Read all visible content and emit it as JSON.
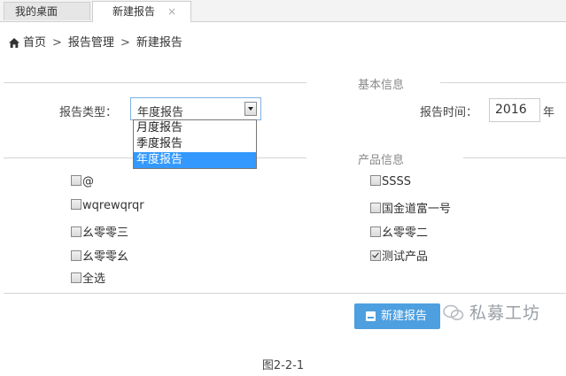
{
  "tabs": [
    {
      "label": "我的桌面"
    },
    {
      "label": "新建报告",
      "close": "×"
    }
  ],
  "breadcrumb": {
    "items": [
      "首页",
      "报告管理",
      "新建报告"
    ],
    "separator": ">"
  },
  "sections": {
    "basic": "基本信息",
    "product": "产品信息"
  },
  "report_type": {
    "label": "报告类型：",
    "value": "年度报告",
    "options": [
      "月度报告",
      "季度报告",
      "年度报告"
    ]
  },
  "report_time": {
    "label": "报告时间：",
    "year": "2016",
    "unit": "年"
  },
  "products": {
    "left": [
      {
        "label": "@",
        "checked": false
      },
      {
        "label": "wqrewqrqr",
        "checked": false
      },
      {
        "label": "幺零零三",
        "checked": false
      },
      {
        "label": "幺零零幺",
        "checked": false
      },
      {
        "label": "全选",
        "checked": false
      }
    ],
    "right": [
      {
        "label": "SSSS",
        "checked": false
      },
      {
        "label": "国金道富一号",
        "checked": false
      },
      {
        "label": "幺零零二",
        "checked": false
      },
      {
        "label": "测试产品",
        "checked": true
      }
    ]
  },
  "submit_button": "新建报告",
  "watermark": "私募工坊",
  "caption": "图2-2-1"
}
